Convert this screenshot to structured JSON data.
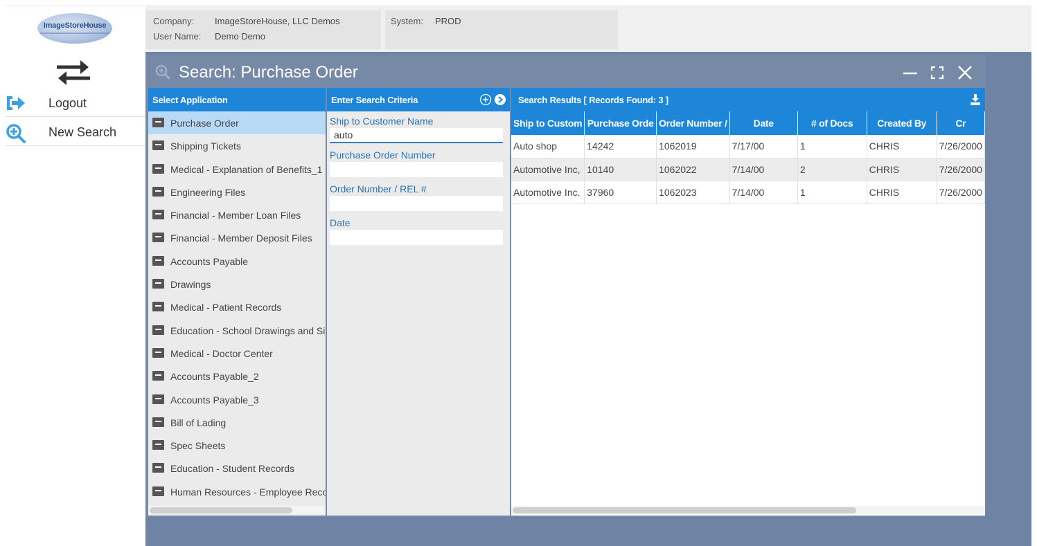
{
  "header": {
    "logo_text": "ImageStoreHouse",
    "company_label": "Company:",
    "company_value": "ImageStoreHouse, LLC Demos",
    "user_label": "User Name:",
    "user_value": "Demo Demo",
    "system_label": "System:",
    "system_value": "PROD"
  },
  "nav": {
    "swap_icon": "swap-arrows-icon",
    "items": [
      {
        "label": "Logout",
        "icon": "logout-icon"
      },
      {
        "label": "New Search",
        "icon": "search-plus-icon"
      }
    ]
  },
  "window": {
    "title": "Search: Purchase Order",
    "controls": [
      "minimize-icon",
      "maximize-icon",
      "close-icon"
    ]
  },
  "apps": {
    "header": "Select Application",
    "selected": "Purchase Order",
    "items": [
      "Purchase Order",
      "Shipping Tickets",
      "Medical - Explanation of Benefits_1",
      "Engineering Files",
      "Financial - Member Loan Files",
      "Financial - Member Deposit Files",
      "Accounts Payable",
      "Drawings",
      "Medical - Patient Records",
      "Education - School Drawings and Site",
      "Medical - Doctor Center",
      "Accounts Payable_2",
      "Accounts Payable_3",
      "Bill of Lading",
      "Spec Sheets",
      "Education - Student Records",
      "Human Resources - Employee Recor"
    ]
  },
  "criteria": {
    "header": "Enter Search Criteria",
    "fields": [
      {
        "label": "Ship to Customer Name",
        "value": "auto"
      },
      {
        "label": "Purchase Order Number",
        "value": ""
      },
      {
        "label": "Order Number / REL #",
        "value": ""
      },
      {
        "label": "Date",
        "value": ""
      }
    ]
  },
  "results": {
    "header": "Search Results [ Records Found: 3 ]",
    "columns": [
      "Ship to Custom",
      "Purchase Orde",
      "Order Number /",
      "Date",
      "# of Docs",
      "Created By",
      "Cr"
    ],
    "rows": [
      [
        "Auto shop",
        "14242",
        "1062019",
        "7/17/00",
        "1",
        "CHRIS",
        "7/26/2000"
      ],
      [
        "Automotive Inc,",
        "10140",
        "1062022",
        "7/14/00",
        "2",
        "CHRIS",
        "7/26/2000"
      ],
      [
        "Automotive Inc.",
        "37960",
        "1062023",
        "7/14/00",
        "1",
        "CHRIS",
        "7/26/2000"
      ]
    ]
  },
  "colors": {
    "accent": "#1d86d8",
    "selected_row": "#b9daf6",
    "workspace": "#6f84a4",
    "nav_icon": "#3aa0e8"
  }
}
